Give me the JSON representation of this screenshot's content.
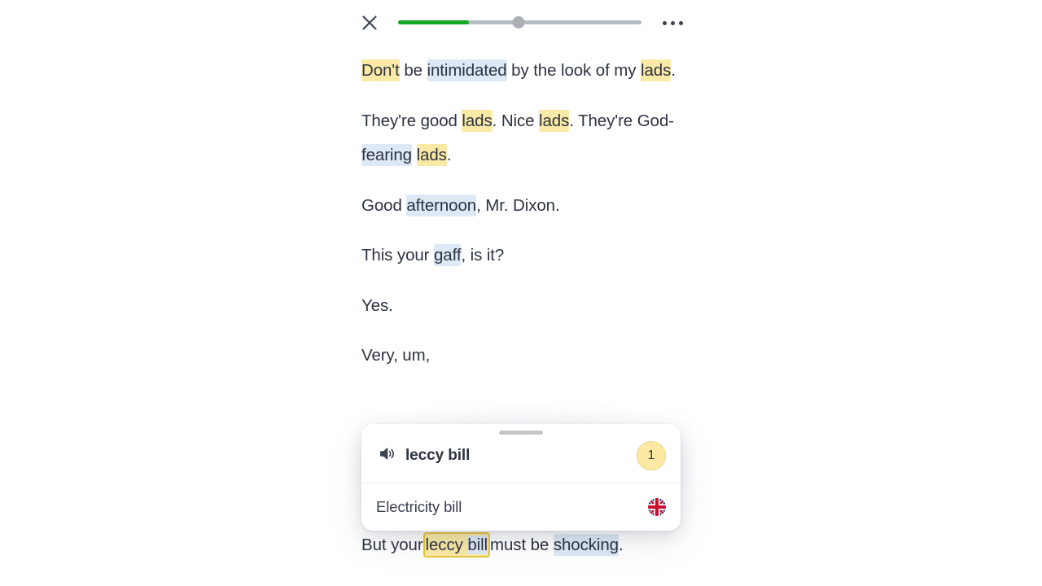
{
  "topbar": {
    "close_icon": "close-icon",
    "menu_icon": "more-horizontal-icon",
    "progress": {
      "played_percent": 29,
      "thumb_percent": 49.5,
      "buffered_percent": 100,
      "fill_color": "#15a623",
      "track_color": "#b6bcc2",
      "thumb_color": "#a9afb5"
    }
  },
  "transcript": {
    "lines": [
      {
        "id": "line-1",
        "text": "Don't be intimidated by the look of my lads."
      },
      {
        "id": "line-2",
        "text": "They're good lads. Nice lads. They're God-fearing lads."
      },
      {
        "id": "line-3",
        "text": "Good afternoon, Mr. Dixon."
      },
      {
        "id": "line-4",
        "text": "This your gaff, is it?"
      },
      {
        "id": "line-5",
        "text": "Yes."
      },
      {
        "id": "line-6",
        "text": "Very, um,"
      },
      {
        "id": "line-7",
        "text": "But your leccy bill must be shocking."
      }
    ],
    "segments": {
      "line1": [
        {
          "t": "Don't",
          "hl": "yellow"
        },
        {
          "t": " be ",
          "hl": "none"
        },
        {
          "t": "intimidated",
          "hl": "blue"
        },
        {
          "t": " by the look of my ",
          "hl": "none"
        },
        {
          "t": "lads",
          "hl": "yellow"
        },
        {
          "t": ".",
          "hl": "none"
        }
      ],
      "line2": [
        {
          "t": "They're good ",
          "hl": "none"
        },
        {
          "t": "lads",
          "hl": "yellow"
        },
        {
          "t": ". Nice ",
          "hl": "none"
        },
        {
          "t": "lads",
          "hl": "yellow"
        },
        {
          "t": ". They're God-",
          "hl": "none"
        },
        {
          "t": "fearing",
          "hl": "blue"
        },
        {
          "t": " ",
          "hl": "none"
        },
        {
          "t": "lads",
          "hl": "yellow"
        },
        {
          "t": ".",
          "hl": "none"
        }
      ],
      "line3": [
        {
          "t": "Good ",
          "hl": "none"
        },
        {
          "t": "afternoon",
          "hl": "blue"
        },
        {
          "t": ", Mr. Dixon.",
          "hl": "none"
        }
      ],
      "line4": [
        {
          "t": "This your ",
          "hl": "none"
        },
        {
          "t": "gaff",
          "hl": "blue"
        },
        {
          "t": ", is it?",
          "hl": "none"
        }
      ],
      "line5": [
        {
          "t": "Yes.",
          "hl": "none"
        }
      ],
      "line6": [
        {
          "t": "Very, um,",
          "hl": "none"
        }
      ],
      "line7": [
        {
          "t": "But your",
          "hl": "none"
        },
        {
          "t": "leccy bill",
          "hl": "yellow-selected"
        },
        {
          "t": "must be ",
          "hl": "none"
        },
        {
          "t": "shocking",
          "hl": "blue"
        },
        {
          "t": ".",
          "hl": "none"
        }
      ]
    },
    "line1_a": "Don't",
    "line1_b": " be ",
    "line1_c": "intimidated",
    "line1_d": " by the look of my ",
    "line1_e": "lads",
    "line1_f": ".",
    "line2_a": "They're good ",
    "line2_b": "lads",
    "line2_c": ". Nice ",
    "line2_d": "lads",
    "line2_e": ". They're God-",
    "line2_f": "fearing",
    "line2_g": " ",
    "line2_h": "lads",
    "line2_i": ".",
    "line3_a": "Good ",
    "line3_b": "afternoon",
    "line3_c": ", Mr. Dixon.",
    "line4_a": "This your ",
    "line4_b": "gaff",
    "line4_c": ", is it?",
    "line5_a": "Yes.",
    "line6_a": "Very, um,",
    "line7_a": "But your",
    "line7_b": "leccy ",
    "line7_c": "bill",
    "line7_d": "must be ",
    "line7_e": "shocking",
    "line7_f": "."
  },
  "popup_card": {
    "drag_handle": "drag-handle",
    "speaker_icon": "speaker-icon",
    "term": "leccy bill",
    "count_badge": "1",
    "translation": "Electricity bill",
    "flag_icon": "uk-flag-icon",
    "badge_bg": "#fbe9a4",
    "badge_border": "#ead57e"
  },
  "colors": {
    "text": "#2e3342",
    "highlight_yellow": "#fbeaa5",
    "highlight_blue": "#dde9f4",
    "selection_border": "#e8c53f",
    "progress_green": "#15a623",
    "background": "#ffffff"
  }
}
